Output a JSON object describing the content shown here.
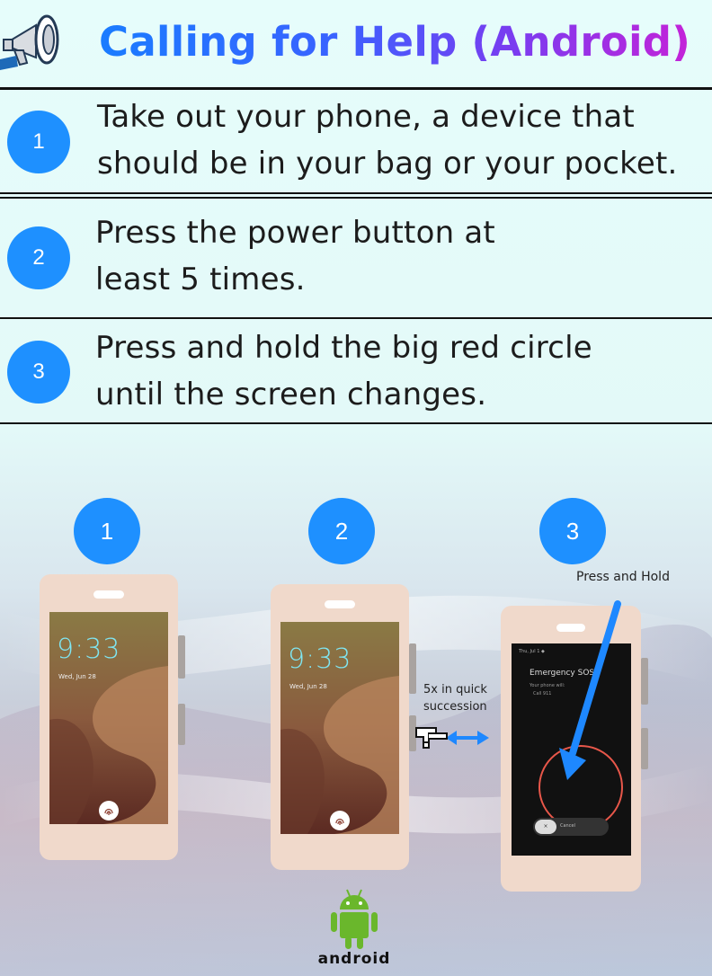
{
  "header": {
    "title": "Calling for Help (Android)",
    "title_gradient": [
      "#1a7cff",
      "#c423d8"
    ]
  },
  "steps": [
    {
      "number": "1",
      "line1": "Take out your phone, a device that",
      "line2": "should be in your bag or your pocket."
    },
    {
      "number": "2",
      "line1": "Press the power button at",
      "line2": "least 5 times."
    },
    {
      "number": "3",
      "line1": "Press and hold the big red circle",
      "line2": "until the screen changes."
    }
  ],
  "illustration": {
    "badges": [
      "1",
      "2",
      "3"
    ],
    "phone1": {
      "time": "9:33",
      "date": "Wed, Jun 28"
    },
    "phone2": {
      "time": "9:33",
      "date": "Wed, Jun 28"
    },
    "phone3": {
      "status": "Thu, Jul 1 ◆",
      "title": "Emergency SOS",
      "subtitle": "Your phone will:",
      "action": "Call 911",
      "cancel": "Cancel",
      "cancel_knob": "×"
    },
    "annotation_press_hold": "Press and Hold",
    "annotation_5x_line1": "5x in quick",
    "annotation_5x_line2": "succession",
    "hand_icon": "pointing-hand-icon",
    "arrow_color": "#1e88ff"
  },
  "footer": {
    "logo_text": "android",
    "robot_color": "#6ab72c"
  },
  "colors": {
    "accent": "#1e90ff",
    "phone_body": "#f0d9cb",
    "sos_ring": "#e8574a"
  }
}
